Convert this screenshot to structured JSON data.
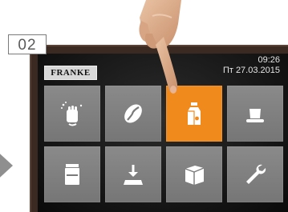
{
  "step": {
    "number": "02"
  },
  "header": {
    "brand": "FRANKE",
    "time": "09:26",
    "date": "Пт 27.03.2015"
  },
  "tiles": [
    {
      "icon": "cleaning-hand-icon",
      "active": false
    },
    {
      "icon": "coffee-bean-icon",
      "active": false
    },
    {
      "icon": "milk-carton-icon",
      "active": true
    },
    {
      "icon": "cup-icon",
      "active": false
    },
    {
      "icon": "powder-container-icon",
      "active": false
    },
    {
      "icon": "drip-tray-icon",
      "active": false
    },
    {
      "icon": "grounds-container-icon",
      "active": false
    },
    {
      "icon": "wrench-icon",
      "active": false
    }
  ],
  "colors": {
    "accent": "#f08a1c",
    "tile": "#808080",
    "screen": "#141414",
    "bezel": "#3a2a22"
  }
}
